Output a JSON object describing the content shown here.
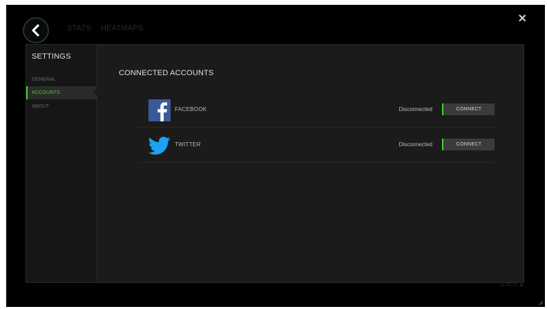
{
  "top_nav": {
    "tabs": [
      {
        "label": "STATS"
      },
      {
        "label": "HEATMAPS"
      }
    ],
    "close_glyph": "✕",
    "bottom_hint": "STATS ▲"
  },
  "settings": {
    "title": "SETTINGS",
    "items": [
      {
        "label": "GENERAL",
        "active": false
      },
      {
        "label": "ACCOUNTS",
        "active": true
      },
      {
        "label": "ABOUT",
        "active": false
      }
    ]
  },
  "connected_accounts": {
    "title": "CONNECTED ACCOUNTS",
    "accounts": [
      {
        "name": "FACEBOOK",
        "status": "Disconnected",
        "button_label": "CONNECT",
        "icon": "facebook-icon"
      },
      {
        "name": "TWITTER",
        "status": "Disconnected",
        "button_label": "CONNECT",
        "icon": "twitter-icon"
      }
    ]
  },
  "colors": {
    "accent": "#44d62c",
    "background": "#000000",
    "panel": "#1b1b1b",
    "facebook_blue": "#3b5998",
    "twitter_blue": "#1da1f2"
  }
}
